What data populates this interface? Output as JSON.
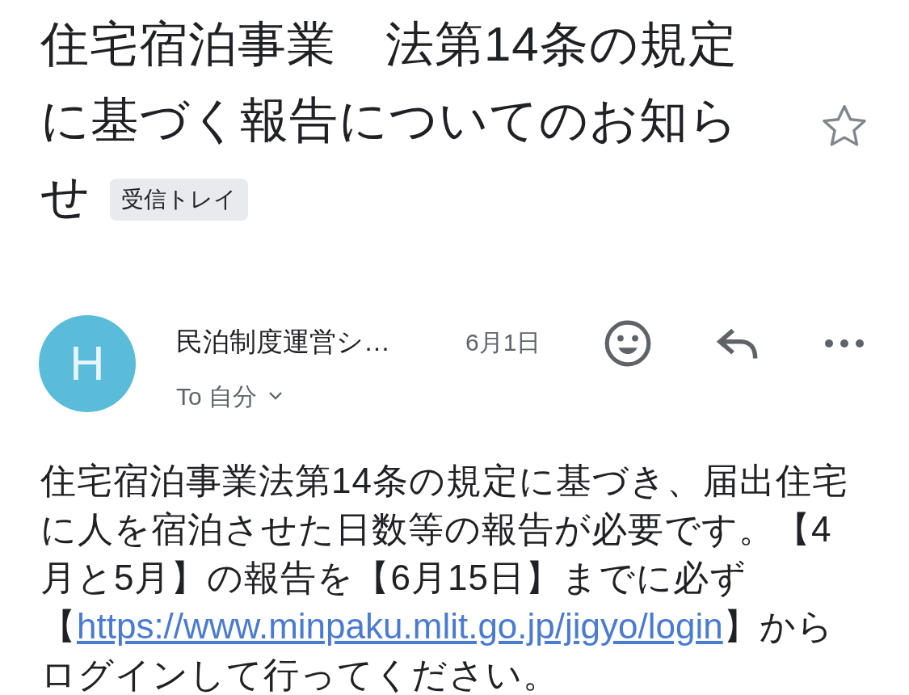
{
  "subject": {
    "title": "住宅宿泊事業　法第14条の規定に基づく報告についてのお知らせ",
    "label": "受信トレイ",
    "starred": false
  },
  "message": {
    "avatar_letter": "H",
    "sender": "民泊制度運営シ…",
    "date": "6月1日",
    "recipient": "To 自分",
    "body": {
      "text_before": "住宅宿泊事業法第14条の規定に基づき、届出住宅に人を宿泊させた日数等の報告が必要です。【4月と5月】の報告を【6月15日】までに必ず【",
      "link": "https://www.minpaku.mlit.go.jp/jigyo/login",
      "text_after": "】からログインして行ってください。"
    }
  }
}
